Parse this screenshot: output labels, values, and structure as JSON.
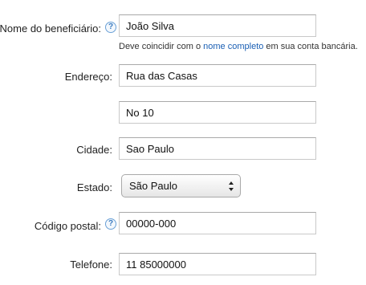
{
  "form": {
    "beneficiary": {
      "label": "Nome do beneficiário:",
      "value": "João Silva",
      "hint_prefix": "Deve coincidir com o ",
      "hint_link": "nome completo",
      "hint_suffix": " em sua conta bancária."
    },
    "address": {
      "label": "Endereço:",
      "line1": "Rua das Casas",
      "line2": "No 10"
    },
    "city": {
      "label": "Cidade:",
      "value": "Sao Paulo"
    },
    "state": {
      "label": "Estado:",
      "value": "São Paulo"
    },
    "postal": {
      "label": "Código postal:",
      "value": "00000-000"
    },
    "phone": {
      "label": "Telefone:",
      "value": "11 85000000"
    },
    "help_glyph": "?"
  },
  "colors": {
    "link": "#1a5fb4",
    "help_icon": "#3b7bc0"
  }
}
